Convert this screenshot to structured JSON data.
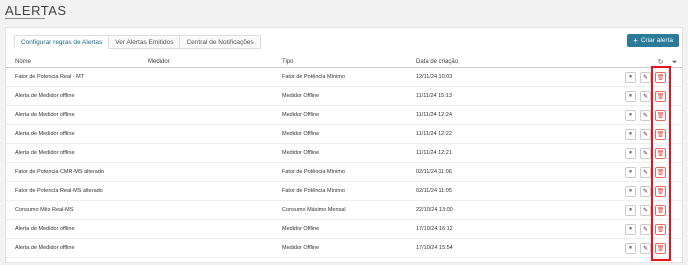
{
  "page": {
    "title": "ALERTAS"
  },
  "tabs": [
    {
      "label": "Configurar regras de Alertas",
      "active": true
    },
    {
      "label": "Ver Alertas Emitidos",
      "active": false
    },
    {
      "label": "Central de Notificações",
      "active": false
    }
  ],
  "toolbar": {
    "create_label": "Criar alerta"
  },
  "table": {
    "columns": [
      "Nome",
      "Medidor",
      "Tipo",
      "Data de criação"
    ],
    "rows": [
      {
        "nome": "Fator de Potencia Real - MT",
        "medidor": "",
        "tipo": "Fator de Potência Mínimo",
        "data": "12/11/24 10:03"
      },
      {
        "nome": "Alerta de Medidor offline",
        "medidor": "",
        "tipo": "Medidor Offline",
        "data": "11/11/24 15:13"
      },
      {
        "nome": "Alerta de Medidor offline",
        "medidor": "",
        "tipo": "Medidor Offline",
        "data": "11/11/24 12:24"
      },
      {
        "nome": "Alerta de Medidor offline",
        "medidor": "",
        "tipo": "Medidor Offline",
        "data": "11/11/24 12:22"
      },
      {
        "nome": "Alerta de Medidor offline",
        "medidor": "",
        "tipo": "Medidor Offline",
        "data": "11/11/24 12:21"
      },
      {
        "nome": "Fator de Potencia CMR-MS alterado",
        "medidor": "",
        "tipo": "Fator de Potência Mínimo",
        "data": "02/11/24 11:06"
      },
      {
        "nome": "Fator de Potencia Real-MS alterado",
        "medidor": "",
        "tipo": "Fator de Potência Mínimo",
        "data": "02/11/24 11:05"
      },
      {
        "nome": "Consumo Mês Real-MS",
        "medidor": "",
        "tipo": "Consumo Máximo Mensal",
        "data": "22/10/24 13:00"
      },
      {
        "nome": "Alerta de Medidor offline",
        "medidor": "",
        "tipo": "Medidor Offline",
        "data": "17/10/24 16:12"
      },
      {
        "nome": "Alerta de Medidor offline",
        "medidor": "",
        "tipo": "Medidor Offline",
        "data": "17/10/24 15:54"
      }
    ]
  },
  "icons": {
    "pause": "⏸",
    "edit": "✎",
    "delete": "🗑",
    "refresh": "↻",
    "filter": "⏷"
  },
  "colors": {
    "accent": "#2a7a98",
    "highlight": "#e4141c",
    "delete": "#e04b4b"
  }
}
